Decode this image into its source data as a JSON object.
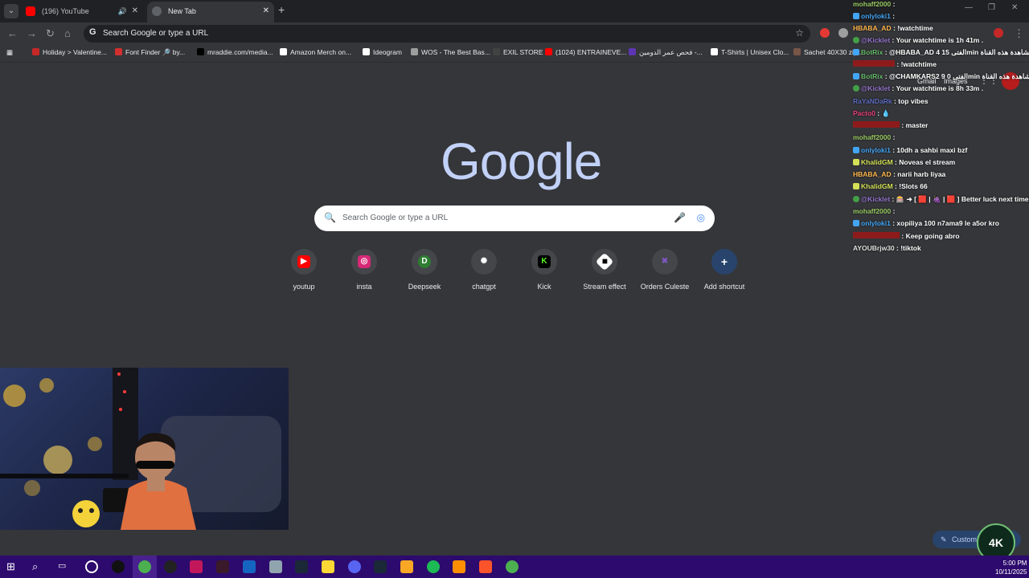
{
  "tabs": [
    {
      "title": "(196) YouTube",
      "active": false,
      "audio_icon": "speaker-icon"
    },
    {
      "title": "New Tab",
      "active": true
    }
  ],
  "omnibox": {
    "placeholder": "Search Google or type a URL"
  },
  "bookmarks": [
    {
      "label": "Holiday > Valentine...",
      "color": "#c62828"
    },
    {
      "label": "Font Finder 🔎 by...",
      "color": "#d32f2f"
    },
    {
      "label": "mraddie.com/media...",
      "color": "#000000"
    },
    {
      "label": "Amazon Merch on...",
      "color": "#ffffff"
    },
    {
      "label": "Ideogram",
      "color": "#ffffff"
    },
    {
      "label": "WOS - The Best Bas...",
      "color": "#9e9e9e"
    },
    {
      "label": "EXIL STORE",
      "color": "#424242"
    },
    {
      "label": "(1024) ENTRAINEVE...",
      "color": "#ff0000"
    },
    {
      "label": "فحص عمر الدومين -...",
      "color": "#5e35b1"
    },
    {
      "label": "T-Shirts | Unisex Clo...",
      "color": "#ffffff"
    },
    {
      "label": "Sachet 40X30 zip...",
      "color": "#795548"
    }
  ],
  "ntp": {
    "logo": "Google",
    "search_placeholder": "Search Google or type a URL",
    "header_links": {
      "gmail": "Gmail",
      "images": "Images"
    },
    "shortcuts": [
      {
        "label": "youtup",
        "icon": "youtube-icon",
        "color": "#ff0000"
      },
      {
        "label": "insta",
        "icon": "instagram-icon",
        "color": "#d62976"
      },
      {
        "label": "Deepseek",
        "icon": "deepseek-icon",
        "color": "#2e7d32"
      },
      {
        "label": "chatgpt",
        "icon": "openai-icon",
        "color": "#44464a"
      },
      {
        "label": "Kick",
        "icon": "kick-icon",
        "color": "#53fc18"
      },
      {
        "label": "Stream effect",
        "icon": "stream-effect-icon",
        "color": "#ffffff"
      },
      {
        "label": "Orders Culeste",
        "icon": "culeste-icon",
        "color": "#7e57c2"
      },
      {
        "label": "Add shortcut",
        "icon": "plus-icon",
        "color": "#28446c"
      }
    ],
    "customize_label": "Customi"
  },
  "chat": [
    {
      "user": "mohaff2000",
      "text": ":",
      "color": "#9ccc65"
    },
    {
      "user": "onlyloki1",
      "text": ":",
      "color": "#42a5f5"
    },
    {
      "user": "HBABA_AD",
      "text": ": !watchtime",
      "color": "#ffb74d"
    },
    {
      "user": "@Kicklet",
      "text": ": Your watchtime is 1h 41m .",
      "color": "#9575cd"
    },
    {
      "user": "BotRix",
      "text": ": @HBABA_AD 4 الفتى 15min مشاهدة هذه القناة",
      "color": "#66bb6a"
    },
    {
      "user": "",
      "text": ": !watchtime",
      "color": "#e53935"
    },
    {
      "user": "BotRix",
      "text": ": @CHAMKARS2 9 الفتى 0min مشاهدة هذه القناة",
      "color": "#66bb6a"
    },
    {
      "user": "@Kicklet",
      "text": ": Your watchtime is 8h 33m .",
      "color": "#9575cd"
    },
    {
      "user": "RaYaNDaRk",
      "text": ": top vibes",
      "color": "#5c6bc0"
    },
    {
      "user": "Pacto0",
      "text": ":",
      "color": "#ec407a"
    },
    {
      "user": "",
      "text": ": master",
      "color": "#e53935"
    },
    {
      "user": "mohaff2000",
      "text": ":",
      "color": "#9ccc65"
    },
    {
      "user": "onlyloki1",
      "text": ": 10dh a sahbi maxi bzf",
      "color": "#42a5f5"
    },
    {
      "user": "KhalidGM",
      "text": ": Noveas el stream",
      "color": "#d4e157"
    },
    {
      "user": "HBABA_AD",
      "text": ": narii harb liyaa",
      "color": "#ffb74d"
    },
    {
      "user": "KhalidGM",
      "text": ": !Slots 66",
      "color": "#d4e157"
    },
    {
      "user": "@Kicklet",
      "text": ": 🎰 ➜ [ 🟥 | 🍇 | 🟥 ] Better luck next time!",
      "color": "#9575cd"
    },
    {
      "user": "mohaff2000",
      "text": ":",
      "color": "#9ccc65"
    },
    {
      "user": "onlyloki1",
      "text": ": xopiliya 100 n7ama9 le a5or kro",
      "color": "#42a5f5"
    },
    {
      "user": "",
      "text": ": Keep going abro",
      "color": "#e53935"
    },
    {
      "user": "AYOUBrjw30",
      "text": ": !tiktok",
      "color": "#e0e0e0"
    }
  ],
  "taskbar": {
    "time": "5:00 PM",
    "date": "10/11/2025",
    "apps": [
      "windows-icon",
      "search-icon",
      "taskview-icon",
      "cortana-icon",
      "app-icon",
      "chrome-icon",
      "obs-icon",
      "app-icon",
      "app-icon",
      "app-icon",
      "app-icon",
      "steam-icon",
      "explorer-icon",
      "discord-icon",
      "steam-icon",
      "files-icon",
      "spotify-icon",
      "vlc-icon",
      "brave-icon",
      "chrome-icon"
    ]
  },
  "overlay_logo": "4K"
}
